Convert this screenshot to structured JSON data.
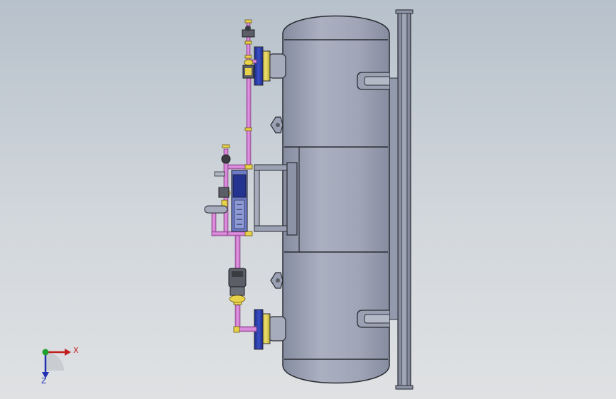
{
  "viewport": {
    "background_top": "#b7c1cb",
    "background_bottom": "#dfe1e3"
  },
  "model": {
    "description_colors": {
      "vessel_body": "#9aa1b3",
      "vessel_outline": "#2a2c33",
      "frame": "#8c93a6",
      "pipe": "#d07cd0",
      "flange_face": "#2a3aa8",
      "gasket": "#e0d050",
      "valve_body": "#5b5e66"
    }
  },
  "triad": {
    "x_label": "X",
    "z_label": "Z",
    "x_color": "#c02020",
    "y_color": "#20a030",
    "z_color": "#2030b0"
  }
}
